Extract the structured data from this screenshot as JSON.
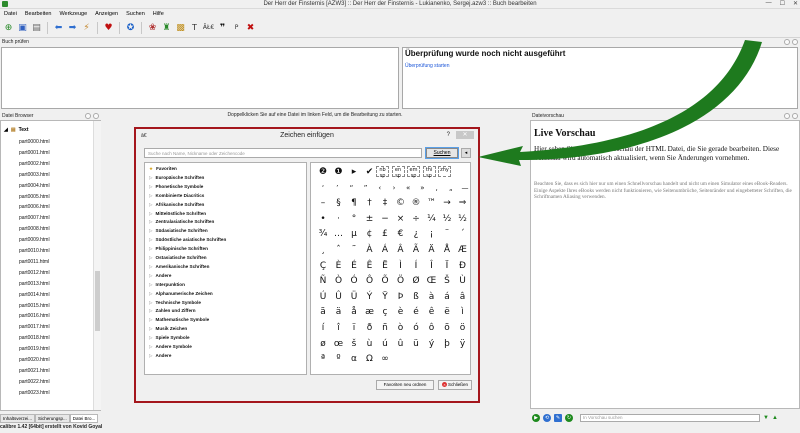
{
  "window": {
    "title": "Der Herr der Finsternis [AZW3] :: Der Herr der Finsternis - Lukianenko, Sergej.azw3 :: Buch bearbeiten"
  },
  "menu": [
    "Datei",
    "Bearbeiten",
    "Werkzeuge",
    "Anzeigen",
    "Suchen",
    "Hilfe"
  ],
  "panels": {
    "check_header": "Buch prüfen",
    "check_text": "Überprüfung wurde noch nicht ausgeführt",
    "check_link": "Überprüfung starten",
    "browser_header": "Datei Browser",
    "preview_header": "Dateivorschau",
    "center_hint": "Doppelklicken Sie auf eine Datei im linken Feld, um die Bearbeitung zu starten."
  },
  "file_browser": {
    "root": "Text",
    "files": [
      "part0000.html",
      "part0001.html",
      "part0002.html",
      "part0003.html",
      "part0004.html",
      "part0005.html",
      "part0006.html",
      "part0007.html",
      "part0008.html",
      "part0009.html",
      "part0010.html",
      "part0011.html",
      "part0012.html",
      "part0013.html",
      "part0014.html",
      "part0015.html",
      "part0016.html",
      "part0017.html",
      "part0018.html",
      "part0019.html",
      "part0020.html",
      "part0021.html",
      "part0022.html",
      "part0023.html"
    ],
    "tabs": [
      "Inhaltsverzei...",
      "Sicherungsp...",
      "Datei Bro..."
    ]
  },
  "status": "calibre 1.42 [64bit] erstellt von Kovid Goyal",
  "dialog": {
    "icon_text": "ā€",
    "title": "Zeichen einfügen",
    "help": "?",
    "search_placeholder": "Suche nach Name, Nickname oder Zeichencode",
    "search_button": "Suchen",
    "favorites_button": "Favoriten neu ordnen",
    "close_button": "Schließen",
    "categories": [
      "Favoriten",
      "Europäische Schriften",
      "Phonetische Symbole",
      "Kombinierte Diacritics",
      "Afrikanische Schriften",
      "Mittelöstliche Schriften",
      "Zentralasiatische Schriften",
      "Südasiatische Schriften",
      "Südöstliche asiatische Schriften",
      "Philippinische Schriften",
      "Ostasiatische Schriften",
      "Amerikanische Schriften",
      "Andere",
      "Interpunktion",
      "Alphanumerische Zeichen",
      "Technische Symbole",
      "Zahlen und Ziffern",
      "Mathematische Symbole",
      "Musik Zeichen",
      "Spiele Symbole",
      "Andere Symbole",
      "Andere"
    ],
    "char_rows": [
      [
        "❷",
        "❶",
        "▸",
        "✔",
        "nb sp",
        "en sp",
        "em sp",
        "thi sp",
        "zhy"
      ],
      [
        "‘",
        "’",
        "“",
        "”",
        "‹",
        "›",
        "«",
        "»",
        "‚",
        "„",
        "—"
      ],
      [
        "–",
        "§",
        "¶",
        "†",
        "‡",
        "©",
        "®",
        "™",
        "→",
        "⇒"
      ],
      [
        "•",
        "·",
        "°",
        "±",
        "−",
        "×",
        "÷",
        "¼",
        "½",
        "½"
      ],
      [
        "¾",
        "…",
        "µ",
        "¢",
        "£",
        "€",
        "¿",
        "¡",
        "¨",
        "´"
      ],
      [
        "¸",
        "ˆ",
        "˜",
        "À",
        "Á",
        "Â",
        "Ã",
        "Ä",
        "Å",
        "Æ"
      ],
      [
        "Ç",
        "È",
        "É",
        "Ê",
        "Ë",
        "Ì",
        "Í",
        "Î",
        "Ï",
        "Ð"
      ],
      [
        "Ñ",
        "Ò",
        "Ó",
        "Ô",
        "Õ",
        "Ö",
        "Ø",
        "Œ",
        "Š",
        "Ù"
      ],
      [
        "Ú",
        "Û",
        "Ü",
        "Ý",
        "Ÿ",
        "Þ",
        "ß",
        "à",
        "á",
        "â"
      ],
      [
        "ã",
        "ä",
        "å",
        "æ",
        "ç",
        "è",
        "é",
        "ê",
        "ë",
        "ì"
      ],
      [
        "í",
        "î",
        "ï",
        "ð",
        "ñ",
        "ò",
        "ó",
        "ô",
        "õ",
        "ö"
      ],
      [
        "ø",
        "œ",
        "š",
        "ù",
        "ú",
        "û",
        "ü",
        "ý",
        "þ",
        "ÿ"
      ],
      [
        "ª",
        "º",
        "α",
        "Ω",
        "∞"
      ]
    ]
  },
  "preview": {
    "title": "Live Vorschau",
    "body": "Hier sehen Sie eine Live Vorschau der HTML Datei, die Sie gerade bearbeiten. Diese Vorschau wird automatisch aktualisiert, wenn Sie Änderungen vornehmen.",
    "note": "Beachten Sie, dass es sich hier nur um einen Schnellvorschau handelt und nicht um einen Simulator eines eBook-Readers. Einige Aspekte Ihres eBooks werden nicht funktionieren, wie Seitenumbrüche, Seitenränder und eingebetteter Schriften, die Schriftnamen Aliasing verwenden.",
    "search_placeholder": "In Vorschau suchen"
  },
  "colors": {
    "dialog_border": "#a4161c",
    "arrow": "#1e7a1e",
    "link": "#1a55d8"
  }
}
